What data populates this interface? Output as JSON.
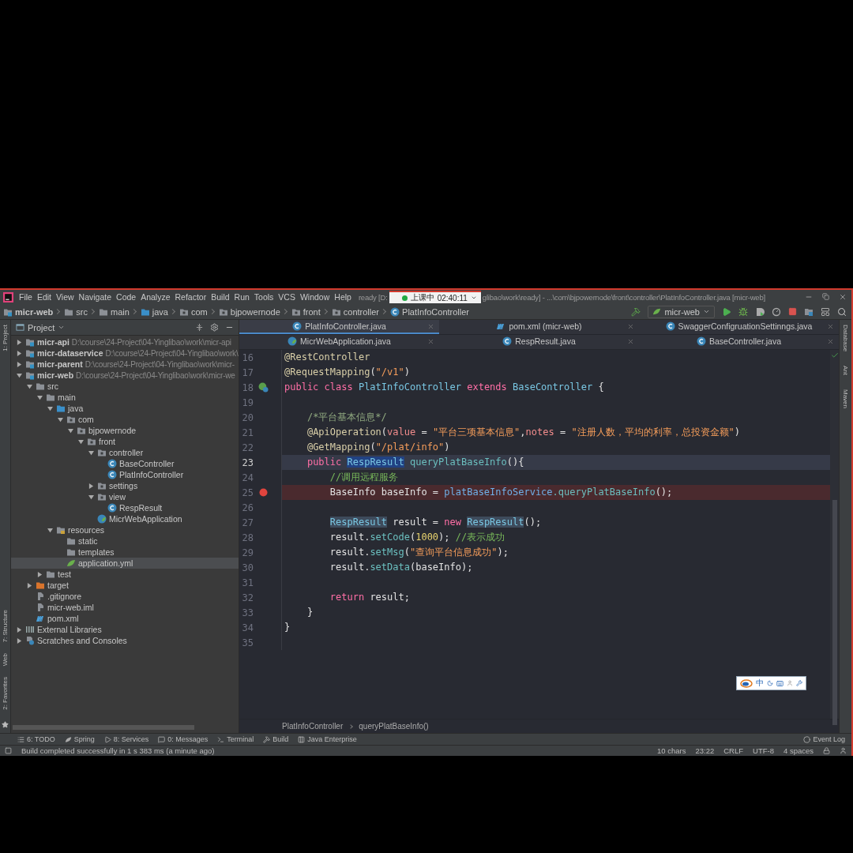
{
  "menu_bar": {
    "items": [
      "File",
      "Edit",
      "View",
      "Navigate",
      "Code",
      "Analyze",
      "Refactor",
      "Build",
      "Run",
      "Tools",
      "VCS",
      "Window",
      "Help"
    ],
    "title_before": "ready [D:",
    "title_after": "glibao\\work\\ready] - ...\\com\\bjpowernode\\front\\controller\\PlatInfoController.java [micr-web]",
    "recording": {
      "label": "上课中",
      "time": "02:40:11"
    }
  },
  "nav_bar": {
    "crumbs": [
      {
        "label": "micr-web",
        "kind": "module"
      },
      {
        "label": "src",
        "kind": "folder"
      },
      {
        "label": "main",
        "kind": "folder"
      },
      {
        "label": "java",
        "kind": "source-folder"
      },
      {
        "label": "com",
        "kind": "package"
      },
      {
        "label": "bjpowernode",
        "kind": "package"
      },
      {
        "label": "front",
        "kind": "package"
      },
      {
        "label": "controller",
        "kind": "package"
      },
      {
        "label": "PlatInfoController",
        "kind": "class"
      }
    ],
    "run_config": "micr-web"
  },
  "left_stripe": {
    "top": [
      "1: Project"
    ],
    "bottom": [
      "7: Structure",
      "Web",
      "2: Favorites"
    ]
  },
  "right_stripe": [
    "Database",
    "Ant",
    "Maven"
  ],
  "project_panel": {
    "title": "Project",
    "tree": [
      {
        "label": "micr-api",
        "kind": "module",
        "path": "D:\\course\\24-Project\\04-Yinglibao\\work\\micr-api",
        "expanded": false,
        "selected": false
      },
      {
        "label": "micr-dataservice",
        "kind": "module",
        "path": "D:\\course\\24-Project\\04-Yinglibao\\work\\",
        "expanded": false,
        "selected": false
      },
      {
        "label": "micr-parent",
        "kind": "module",
        "path": "D:\\course\\24-Project\\04-Yinglibao\\work\\micr-",
        "expanded": false,
        "selected": false
      },
      {
        "label": "micr-web",
        "kind": "module",
        "path": "D:\\course\\24-Project\\04-Yinglibao\\work\\micr-we",
        "expanded": true,
        "selected": false,
        "children": [
          {
            "label": "src",
            "kind": "folder",
            "expanded": true,
            "selected": false,
            "children": [
              {
                "label": "main",
                "kind": "folder",
                "expanded": true,
                "selected": false,
                "children": [
                  {
                    "label": "java",
                    "kind": "source-folder",
                    "expanded": true,
                    "selected": false,
                    "children": [
                      {
                        "label": "com",
                        "kind": "package",
                        "expanded": true,
                        "selected": false,
                        "children": [
                          {
                            "label": "bjpowernode",
                            "kind": "package",
                            "expanded": true,
                            "selected": false,
                            "children": [
                              {
                                "label": "front",
                                "kind": "package",
                                "expanded": true,
                                "selected": false,
                                "children": [
                                  {
                                    "label": "controller",
                                    "kind": "package",
                                    "expanded": true,
                                    "selected": false,
                                    "children": [
                                      {
                                        "label": "BaseController",
                                        "kind": "class",
                                        "selected": false
                                      },
                                      {
                                        "label": "PlatInfoController",
                                        "kind": "class",
                                        "selected": false
                                      }
                                    ]
                                  },
                                  {
                                    "label": "settings",
                                    "kind": "package",
                                    "expanded": false,
                                    "selected": false
                                  },
                                  {
                                    "label": "view",
                                    "kind": "package",
                                    "expanded": true,
                                    "selected": false,
                                    "children": [
                                      {
                                        "label": "RespResult",
                                        "kind": "class",
                                        "selected": false
                                      }
                                    ]
                                  },
                                  {
                                    "label": "MicrWebApplication",
                                    "kind": "spring-class",
                                    "selected": false
                                  }
                                ]
                              }
                            ]
                          }
                        ]
                      }
                    ]
                  },
                  {
                    "label": "resources",
                    "kind": "resources-folder",
                    "expanded": true,
                    "selected": false,
                    "children": [
                      {
                        "label": "static",
                        "kind": "folder",
                        "selected": false
                      },
                      {
                        "label": "templates",
                        "kind": "folder",
                        "selected": false
                      },
                      {
                        "label": "application.yml",
                        "kind": "yml",
                        "selected": true
                      }
                    ]
                  }
                ]
              },
              {
                "label": "test",
                "kind": "folder",
                "expanded": false,
                "selected": false
              }
            ]
          },
          {
            "label": "target",
            "kind": "excluded-folder",
            "expanded": false,
            "selected": false
          },
          {
            "label": ".gitignore",
            "kind": "file",
            "selected": false
          },
          {
            "label": "micr-web.iml",
            "kind": "file",
            "selected": false
          },
          {
            "label": "pom.xml",
            "kind": "maven",
            "selected": false
          }
        ]
      },
      {
        "label": "External Libraries",
        "kind": "libraries",
        "expanded": false,
        "selected": false
      },
      {
        "label": "Scratches and Consoles",
        "kind": "scratches",
        "expanded": false,
        "selected": false
      }
    ]
  },
  "editor": {
    "tab_rows": [
      {
        "tabs": [
          {
            "label": "PlatInfoController.java",
            "kind": "class",
            "selected": true
          },
          {
            "label": "pom.xml (micr-web)",
            "kind": "maven",
            "selected": false
          },
          {
            "label": "SwaggerConfigruationSettinngs.java",
            "kind": "class",
            "selected": false
          }
        ]
      },
      {
        "tabs": [
          {
            "label": "MicrWebApplication.java",
            "kind": "spring-class",
            "selected": false
          },
          {
            "label": "RespResult.java",
            "kind": "class",
            "selected": false
          },
          {
            "label": "BaseController.java",
            "kind": "class",
            "selected": false
          }
        ]
      }
    ],
    "code_lines": [
      {
        "number": "16",
        "kind": "plain",
        "current": false,
        "breakpoint": false,
        "tokens": [
          {
            "kind": "annotation",
            "text": "@RestController"
          }
        ]
      },
      {
        "number": "17",
        "kind": "plain",
        "current": false,
        "breakpoint": false,
        "tokens": [
          {
            "kind": "annotation",
            "text": "@RequestMapping"
          },
          {
            "kind": "plain",
            "text": "("
          },
          {
            "kind": "string",
            "text": "\"/v1\""
          },
          {
            "kind": "plain",
            "text": ")"
          }
        ]
      },
      {
        "number": "18",
        "kind": "bean",
        "current": false,
        "breakpoint": false,
        "tokens": [
          {
            "kind": "keyword",
            "text": "public class "
          },
          {
            "kind": "type",
            "text": "PlatInfoController"
          },
          {
            "kind": "keyword",
            "text": " extends "
          },
          {
            "kind": "type",
            "text": "BaseController"
          },
          {
            "kind": "plain",
            "text": " {"
          }
        ]
      },
      {
        "number": "19",
        "kind": "plain",
        "current": false,
        "breakpoint": false
      },
      {
        "number": "20",
        "kind": "plain",
        "current": false,
        "breakpoint": false,
        "tokens": [
          {
            "kind": "doc",
            "text": "    /*平台基本信息*/"
          }
        ]
      },
      {
        "number": "21",
        "kind": "plain",
        "current": false,
        "breakpoint": false,
        "tokens": [
          {
            "kind": "annotation",
            "text": "    @ApiOperation"
          },
          {
            "kind": "plain",
            "text": "("
          },
          {
            "kind": "param",
            "text": "value"
          },
          {
            "kind": "plain",
            "text": " = "
          },
          {
            "kind": "string",
            "text": "\"平台三项基本信息\""
          },
          {
            "kind": "plain",
            "text": ","
          },
          {
            "kind": "param",
            "text": "notes"
          },
          {
            "kind": "plain",
            "text": " = "
          },
          {
            "kind": "string",
            "text": "\"注册人数，平均的利率，总投资金额\""
          },
          {
            "kind": "plain",
            "text": ")"
          }
        ]
      },
      {
        "number": "22",
        "kind": "plain",
        "current": false,
        "breakpoint": false,
        "tokens": [
          {
            "kind": "annotation",
            "text": "    @GetMapping"
          },
          {
            "kind": "plain",
            "text": "("
          },
          {
            "kind": "string",
            "text": "\"/plat/info\""
          },
          {
            "kind": "plain",
            "text": ")"
          }
        ]
      },
      {
        "number": "23",
        "kind": "plain",
        "current": true,
        "breakpoint": false,
        "tokens": [
          {
            "kind": "keyword",
            "text": "    public "
          },
          {
            "kind": "type",
            "text": "RespResult",
            "selected": true
          },
          {
            "kind": "method",
            "text": " queryPlatBaseInfo"
          },
          {
            "kind": "plain",
            "text": "(){"
          }
        ]
      },
      {
        "number": "24",
        "kind": "plain",
        "current": false,
        "breakpoint": false,
        "tokens": [
          {
            "kind": "comment",
            "text": "        //调用远程服务"
          }
        ]
      },
      {
        "number": "25",
        "kind": "plain",
        "current": false,
        "breakpoint": true,
        "tokens": [
          {
            "kind": "plain",
            "text": "        BaseInfo baseInfo = "
          },
          {
            "kind": "field",
            "text": "platBaseInfoService"
          },
          {
            "kind": "method",
            "text": ".queryPlatBaseInfo"
          },
          {
            "kind": "plain",
            "text": "();"
          }
        ]
      },
      {
        "number": "26",
        "kind": "plain",
        "current": false,
        "breakpoint": false
      },
      {
        "number": "27",
        "kind": "plain",
        "current": false,
        "breakpoint": false,
        "tokens": [
          {
            "kind": "type",
            "text": "        RespResult",
            "usage": true
          },
          {
            "kind": "plain",
            "text": " result = "
          },
          {
            "kind": "keyword",
            "text": "new "
          },
          {
            "kind": "type",
            "text": "RespResult",
            "usage": true
          },
          {
            "kind": "plain",
            "text": "();"
          }
        ]
      },
      {
        "number": "28",
        "kind": "plain",
        "current": false,
        "breakpoint": false,
        "tokens": [
          {
            "kind": "plain",
            "text": "        result."
          },
          {
            "kind": "method",
            "text": "setCode"
          },
          {
            "kind": "plain",
            "text": "("
          },
          {
            "kind": "number",
            "text": "1000"
          },
          {
            "kind": "plain",
            "text": "); "
          },
          {
            "kind": "comment",
            "text": "//表示成功"
          }
        ]
      },
      {
        "number": "29",
        "kind": "plain",
        "current": false,
        "breakpoint": false,
        "tokens": [
          {
            "kind": "plain",
            "text": "        result."
          },
          {
            "kind": "method",
            "text": "setMsg"
          },
          {
            "kind": "plain",
            "text": "("
          },
          {
            "kind": "string",
            "text": "\"查询平台信息成功\""
          },
          {
            "kind": "plain",
            "text": ");"
          }
        ]
      },
      {
        "number": "30",
        "kind": "plain",
        "current": false,
        "breakpoint": false,
        "tokens": [
          {
            "kind": "plain",
            "text": "        result."
          },
          {
            "kind": "method",
            "text": "setData"
          },
          {
            "kind": "plain",
            "text": "(baseInfo);"
          }
        ]
      },
      {
        "number": "31",
        "kind": "plain",
        "current": false,
        "breakpoint": false
      },
      {
        "number": "32",
        "kind": "plain",
        "current": false,
        "breakpoint": false,
        "tokens": [
          {
            "kind": "keyword",
            "text": "        return "
          },
          {
            "kind": "plain",
            "text": "result;"
          }
        ]
      },
      {
        "number": "33",
        "kind": "plain",
        "current": false,
        "breakpoint": false,
        "tokens": [
          {
            "kind": "plain",
            "text": "    }"
          }
        ]
      },
      {
        "number": "34",
        "kind": "plain",
        "current": false,
        "breakpoint": false,
        "tokens": [
          {
            "kind": "plain",
            "text": "}"
          }
        ]
      },
      {
        "number": "35",
        "kind": "plain",
        "current": false,
        "breakpoint": false
      }
    ],
    "breadcrumb": [
      "PlatInfoController",
      "queryPlatBaseInfo()"
    ],
    "ime": {
      "label": "中"
    }
  },
  "tool_windows": {
    "left": [
      {
        "label": "6: TODO",
        "kind": "todo"
      },
      {
        "label": "Spring",
        "kind": "spring"
      },
      {
        "label": "8: Services",
        "kind": "services"
      },
      {
        "label": "0: Messages",
        "kind": "messages"
      },
      {
        "label": "Terminal",
        "kind": "terminal"
      },
      {
        "label": "Build",
        "kind": "build"
      },
      {
        "label": "Java Enterprise",
        "kind": "enterprise"
      }
    ],
    "right": [
      {
        "label": "Event Log",
        "kind": "log"
      }
    ]
  },
  "status_bar": {
    "message": "Build completed successfully in 1 s 383 ms (a minute ago)",
    "items": [
      "10 chars",
      "23:22",
      "CRLF",
      "UTF-8",
      "4 spaces"
    ]
  }
}
